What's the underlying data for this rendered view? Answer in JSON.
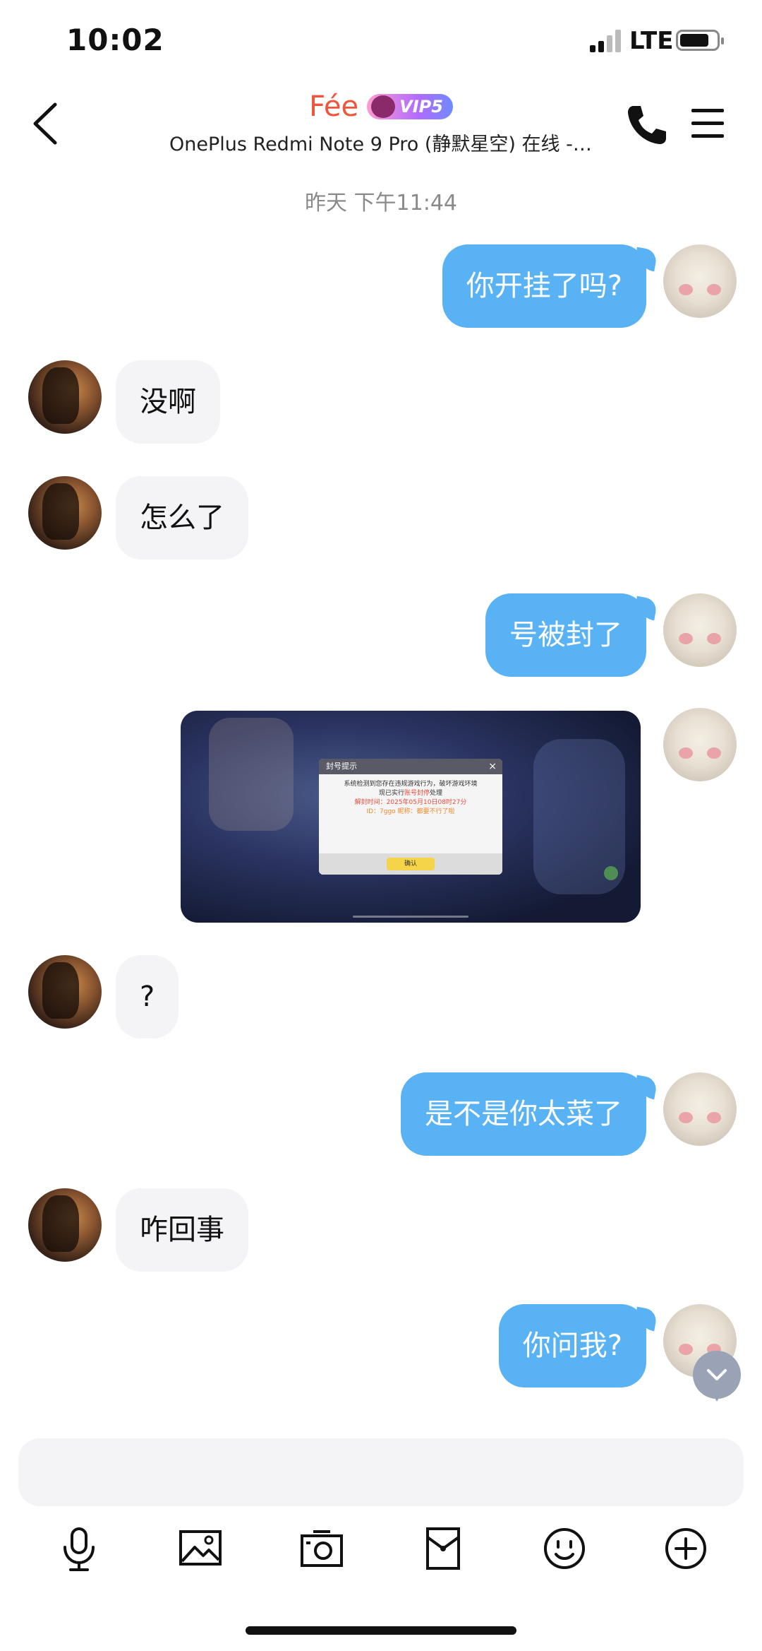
{
  "status_bar": {
    "time": "10:02",
    "network": "LTE"
  },
  "header": {
    "contact_name": "Fée",
    "vip_badge": "VIP5",
    "subtitle": "OnePlus Redmi Note 9 Pro (静默星空) 在线 - W..."
  },
  "timestamp": "昨天 下午11:44",
  "messages": [
    {
      "side": "out",
      "text": "你开挂了吗?"
    },
    {
      "side": "in",
      "text": "没啊"
    },
    {
      "side": "in",
      "text": "怎么了"
    },
    {
      "side": "out",
      "text": "号被封了"
    },
    {
      "side": "out",
      "type": "image"
    },
    {
      "side": "in",
      "text": "?"
    },
    {
      "side": "out",
      "text": "是不是你太菜了"
    },
    {
      "side": "in",
      "text": "咋回事"
    },
    {
      "side": "out",
      "text": "你问我?"
    }
  ],
  "image_dialog": {
    "title": "封号提示",
    "close": "×",
    "line1": "系统检测到您存在违规游戏行为，破坏游戏环境",
    "line2_prefix": "现已实行",
    "line2_highlight": "账号封停",
    "line2_suffix": "处理",
    "line3": "解封时间：2025年05月10日08时27分",
    "line4": "ID：7ggo    昵称：都要不行了啦",
    "confirm": "确认"
  },
  "input": {
    "placeholder": ""
  },
  "toolbar": [
    "microphone-icon",
    "image-icon",
    "camera-icon",
    "red-packet-icon",
    "emoji-icon",
    "plus-icon"
  ],
  "colors": {
    "accent": "#58b2f3",
    "name": "#f0553b",
    "incoming": "#f4f4f6"
  }
}
